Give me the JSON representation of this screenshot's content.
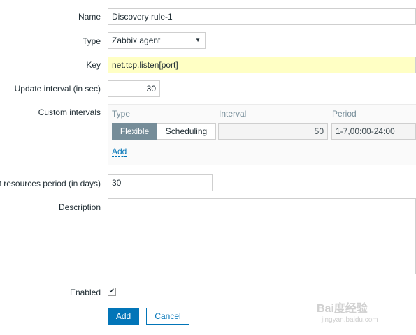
{
  "form": {
    "name": {
      "label": "Name",
      "value": "Discovery rule-1"
    },
    "type": {
      "label": "Type",
      "value": "Zabbix agent"
    },
    "key": {
      "label": "Key",
      "value_underlined": "net.tcp.listen",
      "value_rest": "[port]"
    },
    "update_interval": {
      "label": "Update interval (in sec)",
      "value": "30"
    },
    "custom_intervals": {
      "label": "Custom intervals",
      "headers": {
        "type": "Type",
        "interval": "Interval",
        "period": "Period"
      },
      "row": {
        "flexible": "Flexible",
        "scheduling": "Scheduling",
        "interval": "50",
        "period": "1-7,00:00-24:00"
      },
      "add_link": "Add"
    },
    "lost_resources": {
      "label": "t resources period (in days)",
      "value": "30"
    },
    "description": {
      "label": "Description",
      "value": ""
    },
    "enabled": {
      "label": "Enabled",
      "checked": true,
      "check_glyph": "✔"
    }
  },
  "buttons": {
    "add": "Add",
    "cancel": "Cancel"
  },
  "watermark": {
    "logo": "Bai度经验",
    "url": "jingyan.baidu.com"
  },
  "colors": {
    "accent": "#0275b8",
    "key_bg": "#ffffc4",
    "segment_active": "#768d99"
  }
}
